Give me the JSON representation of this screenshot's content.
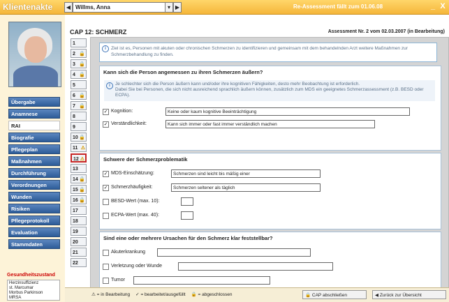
{
  "titlebar": {
    "app_title": "Klientenakte",
    "patient_name": "Willms, Anna",
    "reassessment": "Re-Assessment fällt zum 01.06.08",
    "minimize": "_",
    "close": "X"
  },
  "sidebar": {
    "menu": [
      {
        "label": "Übergabe",
        "active": false
      },
      {
        "label": "Anamnese",
        "active": false
      },
      {
        "label": "RAI",
        "active": true
      },
      {
        "label": "Biografie",
        "active": false
      },
      {
        "label": "Pflegeplan",
        "active": false
      },
      {
        "label": "Maßnahmen",
        "active": false
      },
      {
        "label": "Durchführung",
        "active": false
      },
      {
        "label": "Verordnungen",
        "active": false
      },
      {
        "label": "Wunden",
        "active": false
      },
      {
        "label": "Risiken",
        "active": false
      },
      {
        "label": "Pflegeprotokoll",
        "active": false
      },
      {
        "label": "Evaluation",
        "active": false
      },
      {
        "label": "Stammdaten",
        "active": false
      }
    ],
    "diagnoses_title": "Gesundheitszustand",
    "diagnoses": [
      "Herzinsuffizienz",
      "st. Marcumar",
      "Morbus Parkinson",
      "MRSA"
    ]
  },
  "main": {
    "cap_title": "CAP 12: SCHMERZ",
    "assessment": "Assessment Nr. 2 vom 02.03.2007 (in Bearbeitung)",
    "steps": [
      {
        "label": "1",
        "icon": ""
      },
      {
        "label": "2",
        "icon": "lock"
      },
      {
        "label": "3",
        "icon": "lock"
      },
      {
        "label": "4",
        "icon": "lock"
      },
      {
        "label": "5",
        "icon": ""
      },
      {
        "label": "6",
        "icon": "lock"
      },
      {
        "label": "7",
        "icon": "lock"
      },
      {
        "label": "8",
        "icon": ""
      },
      {
        "label": "9",
        "icon": ""
      },
      {
        "label": "10",
        "icon": "lock"
      },
      {
        "label": "11",
        "icon": "warn"
      },
      {
        "label": "12",
        "icon": "warn",
        "active": true
      },
      {
        "label": "13",
        "icon": ""
      },
      {
        "label": "14",
        "icon": "lock"
      },
      {
        "label": "15",
        "icon": "lock"
      },
      {
        "label": "16",
        "icon": "lock"
      },
      {
        "label": "17",
        "icon": ""
      },
      {
        "label": "18",
        "icon": ""
      },
      {
        "label": "19",
        "icon": ""
      },
      {
        "label": "20",
        "icon": ""
      },
      {
        "label": "21",
        "icon": ""
      },
      {
        "label": "22",
        "icon": ""
      }
    ],
    "intro": "Ziel ist es, Personen mit akuten oder chronischen Schmerzen zu identifizieren und gemeinsam mit dem behandelnden Arzt weitere Maßnahmen zur Schmerzbehandlung zu finden.",
    "q1": {
      "title": "Kann sich die Person angemessen zu ihren Schmerzen äußern?",
      "hint_line1": "Je schlechter sich die Person äußern kann und/oder ihre kognitiven Fähigkeiten, desto mehr Beobachtung ist erforderlich.",
      "hint_line2": "Dabei Sie bei Personen, die sich nicht ausreichend sprachlich äußern können, zusätzlich zum MDS ein geeignetes Schmerzassessment (z.B. BESD oder ECPA).",
      "rows": [
        {
          "label": "Kognition:",
          "checked": true,
          "value": "Keine oder kaum kognitive Beeinträchtigung"
        },
        {
          "label": "Verständlichkeit:",
          "checked": true,
          "value": "Kann sich immer oder fast immer verständlich machen"
        }
      ]
    },
    "q2": {
      "title": "Schwere der Schmerzproblematik",
      "rows": [
        {
          "label": "MDS-Einschätzung:",
          "checked": true,
          "value": "Schmerzen sind leicht bis mäßig einer"
        },
        {
          "label": "Schmerzhäufigkeit:",
          "checked": true,
          "value": "Schmerzen seltener als täglich"
        },
        {
          "label": "BESD-Wert (max. 10):",
          "checked": false,
          "value": ""
        },
        {
          "label": "ECPA-Wert (max. 40):",
          "checked": false,
          "value": ""
        }
      ]
    },
    "q3": {
      "title": "Sind eine oder mehrere Ursachen für den Schmerz klar feststellbar?",
      "rows": [
        {
          "label": "Akuterkrankung",
          "checked": false,
          "value": ""
        },
        {
          "label": "Verletzung oder Wunde",
          "checked": false,
          "value": ""
        },
        {
          "label": "Tumor",
          "checked": false,
          "value": ""
        }
      ]
    }
  },
  "bottombar": {
    "legend": [
      {
        "symbol": "⚠",
        "text": "= in Bearbeitung"
      },
      {
        "symbol": "✓",
        "text": "= bearbeitet/ausgefüllt"
      },
      {
        "symbol": "🔒",
        "text": "= abgeschlossen"
      }
    ],
    "cap_button": "CAP abschließen",
    "back_button": "Zurück zur Übersicht"
  }
}
